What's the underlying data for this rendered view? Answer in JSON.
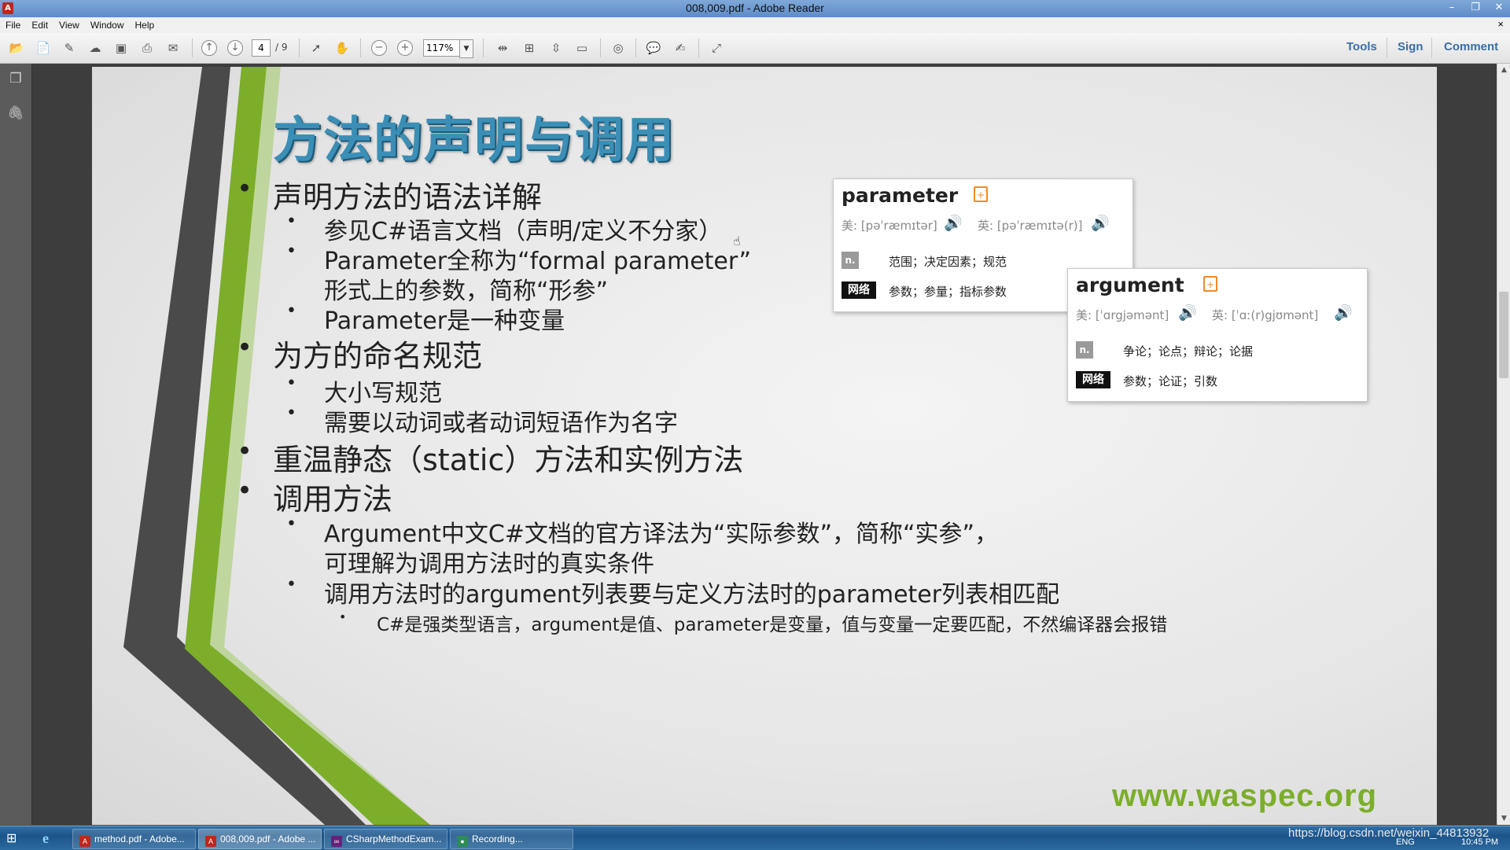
{
  "window": {
    "title": "008,009.pdf - Adobe Reader",
    "app_icon": "adobe-reader-icon",
    "controls": [
      "–",
      "❐",
      "✕"
    ]
  },
  "menu": {
    "items": [
      "File",
      "Edit",
      "View",
      "Window",
      "Help"
    ],
    "doc_close": "×"
  },
  "toolbar": {
    "page_current": "4",
    "page_total": "/ 9",
    "zoom": "117%",
    "tools_label": "Tools",
    "sign_label": "Sign",
    "comment_label": "Comment"
  },
  "slide": {
    "title": "方法的声明与调用",
    "bullets": [
      {
        "level": 1,
        "text": "声明方法的语法详解"
      },
      {
        "level": 2,
        "text": "参见C#语言文档（声明/定义不分家）"
      },
      {
        "level": 2,
        "text": "Parameter全称为“formal parameter”"
      },
      {
        "level": 2,
        "text": "形式上的参数，简称“形参”",
        "continuation": true
      },
      {
        "level": 2,
        "text": "Parameter是一种变量"
      },
      {
        "level": 1,
        "text": "为方的命名规范"
      },
      {
        "level": 2,
        "text": "大小写规范"
      },
      {
        "level": 2,
        "text": "需要以动词或者动词短语作为名字"
      },
      {
        "level": 1,
        "text": "重温静态（static）方法和实例方法"
      },
      {
        "level": 1,
        "text": "调用方法"
      },
      {
        "level": 2,
        "text": "Argument中文C#文档的官方译法为“实际参数”，简称“实参”，"
      },
      {
        "level": 2,
        "text": "可理解为调用方法时的真实条件",
        "continuation": true
      },
      {
        "level": 2,
        "text": "调用方法时的argument列表要与定义方法时的parameter列表相匹配"
      },
      {
        "level": 3,
        "text": "C#是强类型语言，argument是值、parameter是变量，值与变量一定要匹配，不然编译器会报错"
      }
    ],
    "watermark": "www.waspec.org",
    "colors": {
      "accent_green": "#7cae2a",
      "stripe_dark": "#4a4a4a",
      "title_blue": "#3b8fb6"
    }
  },
  "dict_popups": [
    {
      "word": "parameter",
      "us": "美: [pəˈræmɪtər]",
      "uk": "英: [pəˈræmɪtə(r)]",
      "pos": "n.",
      "pos_def": "范围；决定因素；规范",
      "net_label": "网络",
      "net_def": "参数；参量；指标参数"
    },
    {
      "word": "argument",
      "us": "美: [ˈɑrgjəmənt]",
      "uk": "英: [ˈɑː(r)gjʊmənt]",
      "pos": "n.",
      "pos_def": "争论；论点；辩论；论据",
      "net_label": "网络",
      "net_def": "参数；论证；引数"
    }
  ],
  "taskbar": {
    "tasks": [
      "method.pdf - Adobe...",
      "008,009.pdf - Adobe ...",
      "CSharpMethodExam...",
      "Recording..."
    ],
    "tray_url": "https://blog.csdn.net/weixin_44813932",
    "lang": "ENG",
    "time": "10:45 PM"
  }
}
